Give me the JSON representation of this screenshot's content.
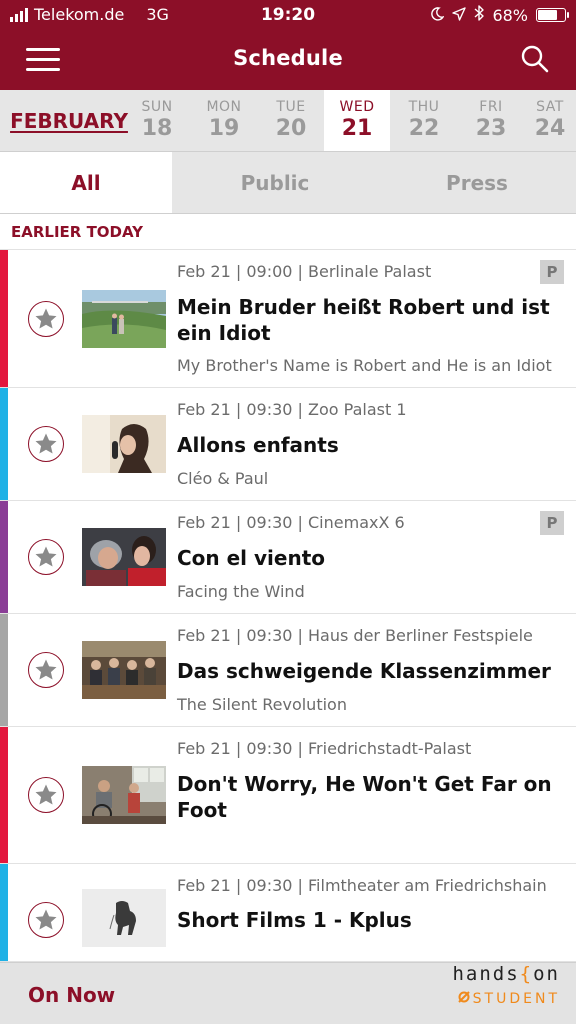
{
  "status": {
    "carrier": "Telekom.de",
    "network": "3G",
    "time": "19:20",
    "battery": "68%",
    "battery_level": 0.68
  },
  "header": {
    "title": "Schedule"
  },
  "dates": {
    "month": "FEBRUARY",
    "days": [
      {
        "name": "SUN",
        "num": "18"
      },
      {
        "name": "MON",
        "num": "19"
      },
      {
        "name": "TUE",
        "num": "20"
      },
      {
        "name": "WED",
        "num": "21"
      },
      {
        "name": "THU",
        "num": "22"
      },
      {
        "name": "FRI",
        "num": "23"
      },
      {
        "name": "SAT",
        "num": "24"
      }
    ],
    "active_index": 3
  },
  "tabs": [
    {
      "label": "All"
    },
    {
      "label": "Public"
    },
    {
      "label": "Press"
    }
  ],
  "section": {
    "label": "EARLIER TODAY"
  },
  "events": [
    {
      "meta": "Feb 21 | 09:00 | Berlinale Palast",
      "title": "Mein Bruder heißt Robert und ist ein Idiot",
      "subtitle": "My Brother's Name is Robert and He is an Idiot",
      "badge": "P",
      "color": "#e3173e"
    },
    {
      "meta": "Feb 21 | 09:30 | Zoo Palast 1",
      "title": "Allons enfants",
      "subtitle": "Cléo & Paul",
      "badge": "",
      "color": "#1fb1e6"
    },
    {
      "meta": "Feb 21 | 09:30 | CinemaxX 6",
      "title": "Con el viento",
      "subtitle": "Facing the Wind",
      "badge": "P",
      "color": "#8a3d96"
    },
    {
      "meta": "Feb 21 | 09:30 | Haus der Berliner Festspiele",
      "title": "Das schweigende Klassenzimmer",
      "subtitle": "The Silent Revolution",
      "badge": "",
      "color": "#a6a6a6"
    },
    {
      "meta": "Feb 21 | 09:30 | Friedrichstadt-Palast",
      "title": "Don't Worry, He Won't Get Far on Foot",
      "subtitle": "",
      "badge": "",
      "color": "#e3173e"
    },
    {
      "meta": "Feb 21 | 09:30 | Filmtheater am Friedrichshain",
      "title": "Short Films 1 - Kplus",
      "subtitle": "",
      "badge": "",
      "color": "#1fb1e6"
    }
  ],
  "bottom": {
    "on_now": "On Now",
    "brand_line1_a": "hands",
    "brand_line1_b": "{",
    "brand_line1_c": "on",
    "brand_line2": "STUDENT"
  },
  "colors": {
    "brand": "#8c0f28",
    "accent_orange": "#f08a1c"
  },
  "icons": [
    "hamburger-icon",
    "search-icon",
    "star-icon",
    "moon-icon",
    "location-arrow-icon",
    "bluetooth-icon",
    "battery-icon"
  ]
}
